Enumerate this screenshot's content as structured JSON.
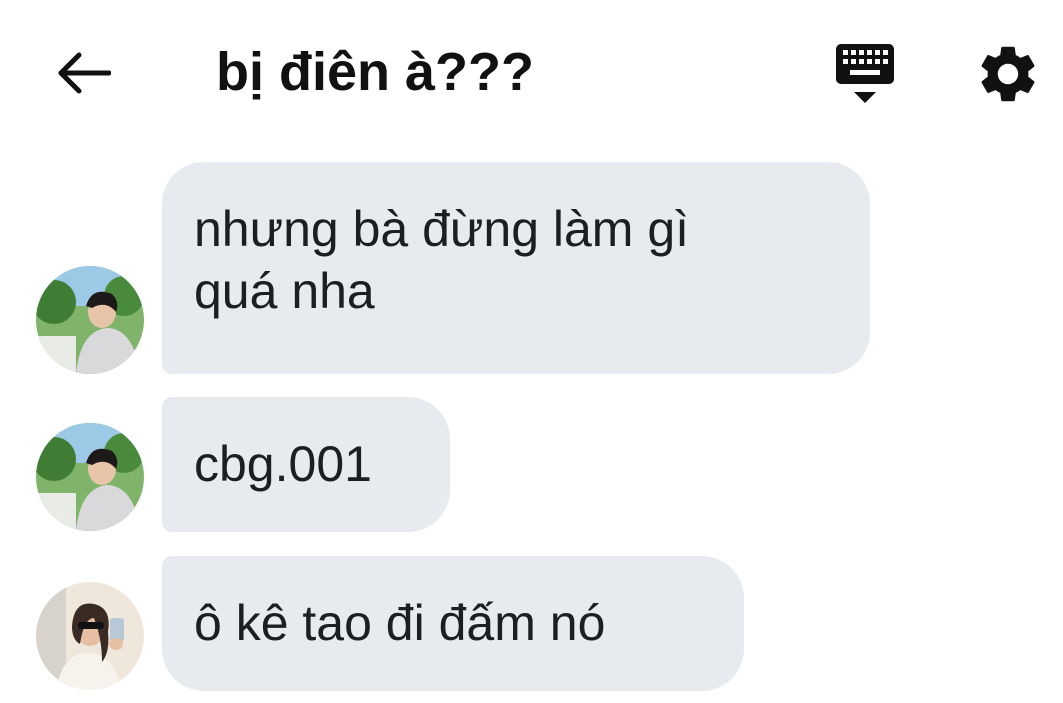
{
  "header": {
    "title": "bị điên à???",
    "back_icon": "arrow-left-icon",
    "keyboard_icon": "keyboard-icon",
    "settings_icon": "gear-icon"
  },
  "messages": [
    {
      "text_line1": "nhưng bà đừng làm gì",
      "text_line2": "quá nha"
    },
    {
      "text": "cbg.001"
    },
    {
      "text": "ô kê tao đi đấm nó"
    }
  ],
  "colors": {
    "bubble": "#e7ebf0",
    "text": "#1c1e21",
    "background": "#ffffff"
  }
}
